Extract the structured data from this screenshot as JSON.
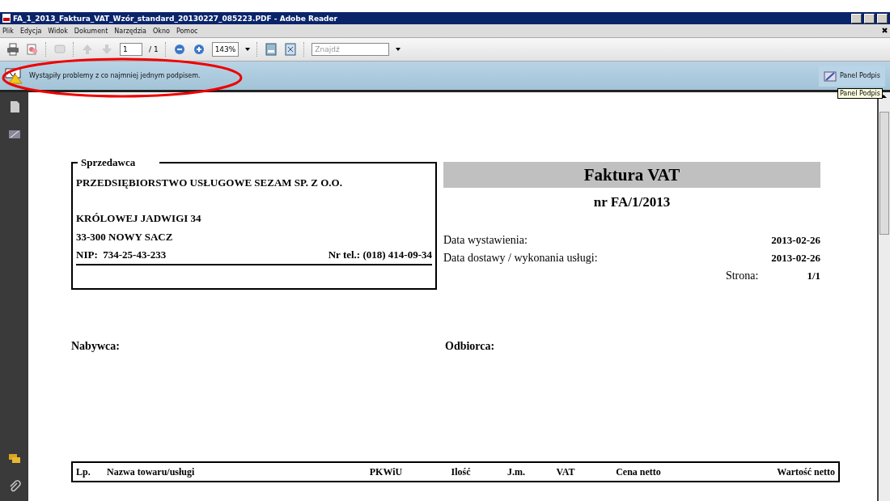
{
  "window": {
    "title": "FA_1_2013_Faktura_VAT_Wzór_standard_20130227_085223.PDF - Adobe Reader"
  },
  "menu": [
    "Plik",
    "Edycja",
    "Widok",
    "Dokument",
    "Narzędzia",
    "Okno",
    "Pomoc"
  ],
  "toolbar": {
    "page": "1",
    "page_total": "/ 1",
    "zoom": "143%",
    "search": {
      "placeholder": "Znajdź"
    }
  },
  "signature_bar": {
    "message": "Wystąpiły problemy z co najmniej jednym podpisem.",
    "button": "Panel Podpis",
    "tooltip": "Panel Podpis"
  },
  "document": {
    "seller": {
      "label": "Sprzedawca",
      "name": "PRZEDSIĘBIORSTWO USŁUGOWE SEZAM SP. Z O.O.",
      "street": "KRÓLOWEJ JADWIGI 34",
      "city": "33-300 NOWY SACZ",
      "nip": "NIP:  734-25-43-233",
      "phone": "Nr tel.: (018) 414-09-34"
    },
    "title": "Faktura VAT",
    "number": "nr FA/1/2013",
    "fields": [
      {
        "label": "Data wystawienia:",
        "value": "2013-02-26"
      },
      {
        "label": "Data dostawy / wykonania usługi:",
        "value": "2013-02-26"
      },
      {
        "label": "Strona:",
        "value": "1/1"
      }
    ],
    "buyer_label": "Nabywca:",
    "recipient_label": "Odbiorca:",
    "table": {
      "columns": [
        "Lp.",
        "Nazwa towaru/usługi",
        "PKWiU",
        "Ilość",
        "J.m.",
        "VAT",
        "Cena netto",
        "Wartość netto"
      ]
    }
  }
}
